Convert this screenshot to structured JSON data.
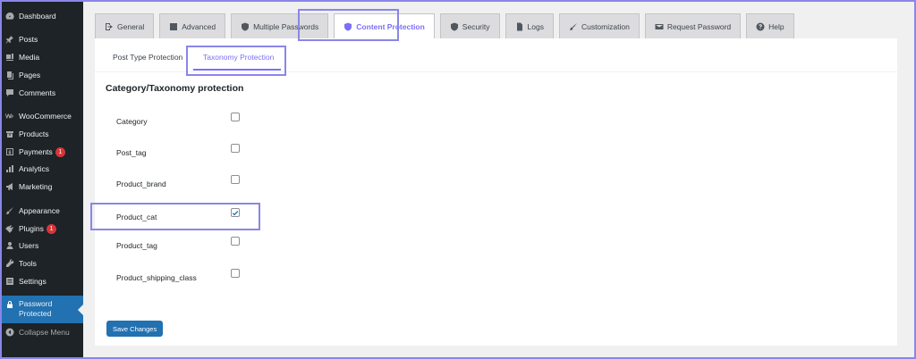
{
  "sidebar": {
    "items": [
      {
        "label": "Dashboard",
        "icon": "dashboard-icon"
      },
      {
        "label": "Posts",
        "icon": "pin-icon"
      },
      {
        "label": "Media",
        "icon": "media-icon"
      },
      {
        "label": "Pages",
        "icon": "pages-icon"
      },
      {
        "label": "Comments",
        "icon": "comment-icon"
      },
      {
        "label": "WooCommerce",
        "icon": "woocommerce-icon"
      },
      {
        "label": "Products",
        "icon": "archive-icon"
      },
      {
        "label": "Payments",
        "icon": "dollar-icon",
        "badge": "1"
      },
      {
        "label": "Analytics",
        "icon": "bar-chart-icon"
      },
      {
        "label": "Marketing",
        "icon": "megaphone-icon"
      },
      {
        "label": "Appearance",
        "icon": "brush-icon"
      },
      {
        "label": "Plugins",
        "icon": "plug-icon",
        "badge": "1"
      },
      {
        "label": "Users",
        "icon": "users-icon"
      },
      {
        "label": "Tools",
        "icon": "wrench-icon"
      },
      {
        "label": "Settings",
        "icon": "settings-icon"
      }
    ],
    "active_item": {
      "label_line1": "Password",
      "label_line2": "Protected",
      "icon": "lock-icon"
    },
    "collapse_label": "Collapse Menu"
  },
  "tabs": [
    {
      "label": "General",
      "icon": "exit-icon"
    },
    {
      "label": "Advanced",
      "icon": "terminal-icon"
    },
    {
      "label": "Multiple Passwords",
      "icon": "shield-icon"
    },
    {
      "label": "Content Protection",
      "icon": "shield-icon",
      "active": true
    },
    {
      "label": "Security",
      "icon": "shield-icon"
    },
    {
      "label": "Logs",
      "icon": "document-icon"
    },
    {
      "label": "Customization",
      "icon": "brush-icon"
    },
    {
      "label": "Request Password",
      "icon": "email-icon"
    },
    {
      "label": "Help",
      "icon": "help-icon"
    }
  ],
  "subtabs": [
    {
      "label": "Post Type Protection"
    },
    {
      "label": "Taxonomy Protection",
      "active": true
    }
  ],
  "section_title": "Category/Taxonomy protection",
  "rows": [
    {
      "label": "Category",
      "checked": false
    },
    {
      "label": "Post_tag",
      "checked": false
    },
    {
      "label": "Product_brand",
      "checked": false
    },
    {
      "label": "Product_cat",
      "checked": true
    },
    {
      "label": "Product_tag",
      "checked": false
    },
    {
      "label": "Product_shipping_class",
      "checked": false
    }
  ],
  "save_label": "Save Changes",
  "colors": {
    "accent": "#7c6ff7",
    "highlight": "#8a86e8",
    "sidebar_bg": "#1d2327",
    "active_blue": "#2271b1",
    "badge_red": "#d63638"
  }
}
